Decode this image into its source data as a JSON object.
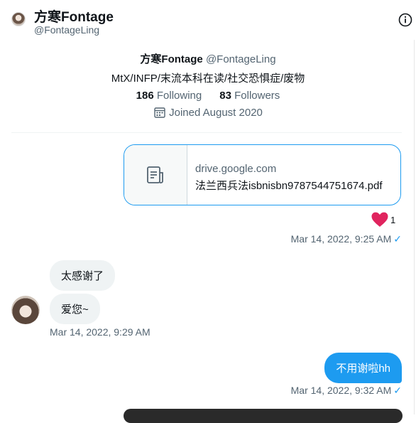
{
  "header": {
    "name": "方寒Fontage",
    "handle": "@FontageLing"
  },
  "profile": {
    "name": "方寒Fontage",
    "handle": "@FontageLing",
    "bio": "MtX/INFP/末流本科在读/社交恐惧症/废物",
    "following_count": "186",
    "following_label": "Following",
    "followers_count": "83",
    "followers_label": "Followers",
    "joined": "Joined August 2020"
  },
  "messages": {
    "card_domain": "drive.google.com",
    "card_title": "法兰西兵法isbnisbn9787544751674.pdf",
    "reaction_count": "1",
    "ts1": "Mar 14, 2022, 9:25 AM",
    "in_msg1": "太感谢了",
    "in_msg2": "爱您~",
    "ts2": "Mar 14, 2022, 9:29 AM",
    "out_msg": "不用谢啦hh",
    "ts3": "Mar 14, 2022, 9:32 AM",
    "check": "✓"
  },
  "colors": {
    "accent": "#1d9bf0",
    "heart": "#f91880",
    "muted": "#536471"
  },
  "icons": [
    "info-icon",
    "calendar-icon",
    "document-icon",
    "heart-icon",
    "check-icon"
  ]
}
